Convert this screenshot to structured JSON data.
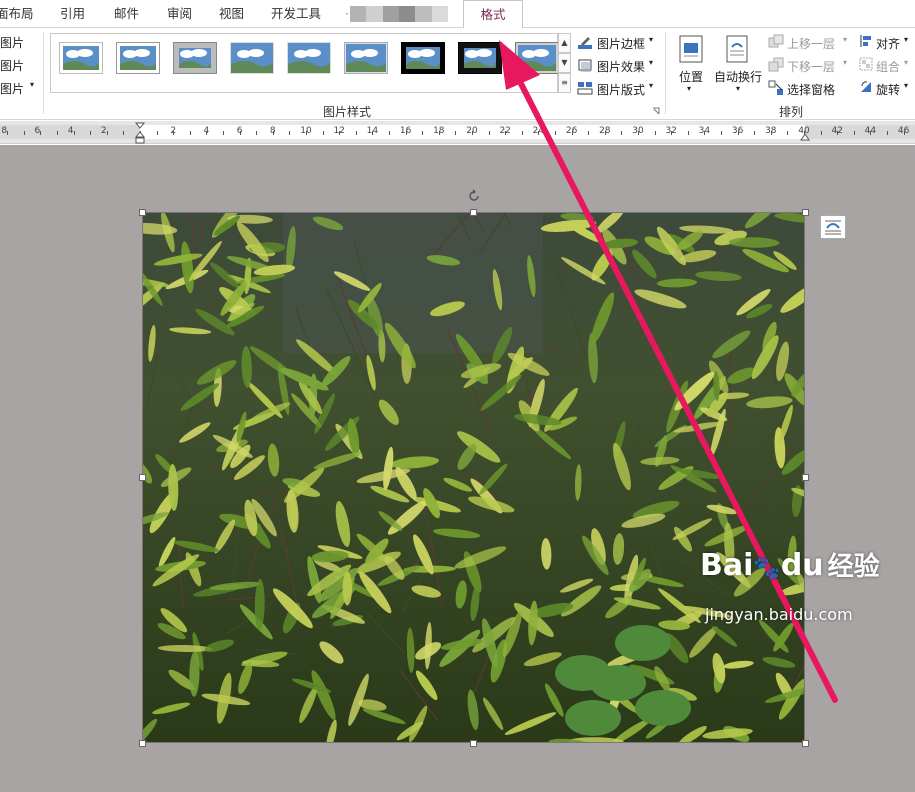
{
  "tabs": [
    {
      "label": "面布局",
      "active": false
    },
    {
      "label": "引用",
      "active": false
    },
    {
      "label": "邮件",
      "active": false
    },
    {
      "label": "审阅",
      "active": false
    },
    {
      "label": "视图",
      "active": false
    },
    {
      "label": "开发工具",
      "active": false
    },
    {
      "label": "格式",
      "active": true
    }
  ],
  "left_group": {
    "items": [
      "图片",
      "图片",
      "图片"
    ]
  },
  "picture_styles": {
    "group_label": "图片样式",
    "styles": [
      "simple-frame-white",
      "shadow-frame",
      "gray-matte",
      "soft-edge",
      "reflected",
      "bevel",
      "black-frame-thick",
      "black-frame-double",
      "metal-frame"
    ],
    "commands": [
      {
        "label": "图片边框",
        "icon": "border-pen-icon"
      },
      {
        "label": "图片效果",
        "icon": "effects-icon"
      },
      {
        "label": "图片版式",
        "icon": "layout-icon"
      }
    ]
  },
  "arrange": {
    "group_label": "排列",
    "position_label": "位置",
    "wrap_label": "自动换行",
    "bring_forward": "上移一层",
    "send_backward": "下移一层",
    "selection_pane": "选择窗格",
    "align": "对齐",
    "group": "组合",
    "rotate": "旋转"
  },
  "ruler": {
    "left_numbers": [
      "8",
      "6",
      "4",
      "2"
    ],
    "right_numbers": [
      "2",
      "4",
      "6",
      "8",
      "10",
      "12",
      "14",
      "16",
      "18",
      "20",
      "22",
      "24",
      "26",
      "28",
      "30",
      "32",
      "34",
      "36",
      "38",
      "40",
      "42",
      "44",
      "46"
    ]
  },
  "colors": {
    "accent": "#7b2a5a",
    "canvas": "#a8a4a4",
    "arrow": "#e8185e"
  },
  "watermark": {
    "brand": "Bai",
    "brand2": "du",
    "suffix": "经验",
    "url": "jingyan.baidu.com"
  }
}
